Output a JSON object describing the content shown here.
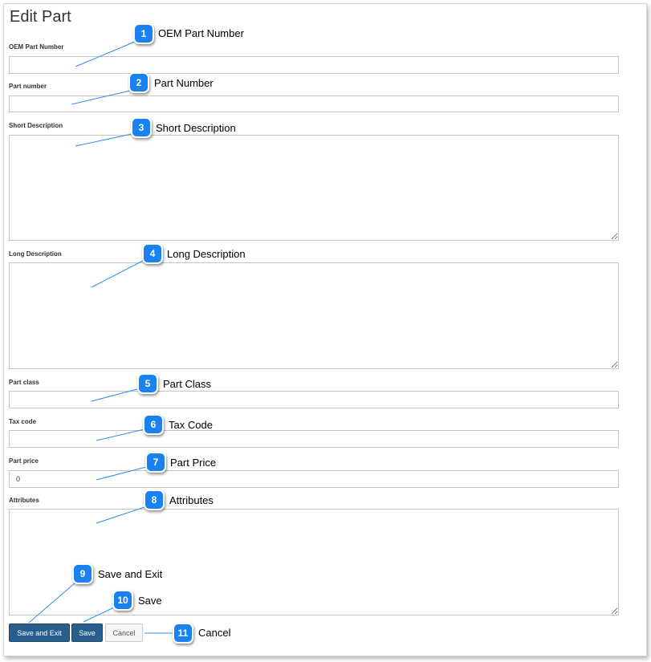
{
  "page_title": "Edit Part",
  "fields": {
    "oem_part_number": {
      "label": "OEM Part Number",
      "value": ""
    },
    "part_number": {
      "label": "Part number",
      "value": ""
    },
    "short_description": {
      "label": "Short Description",
      "value": ""
    },
    "long_description": {
      "label": "Long Description",
      "value": ""
    },
    "part_class": {
      "label": "Part class",
      "value": ""
    },
    "tax_code": {
      "label": "Tax code",
      "value": ""
    },
    "part_price": {
      "label": "Part price",
      "value": "0"
    },
    "attributes": {
      "label": "Attributes",
      "value": ""
    }
  },
  "buttons": {
    "save_and_exit": "Save and Exit",
    "save": "Save",
    "cancel": "Cancel"
  },
  "callouts": [
    {
      "number": "1",
      "text": "OEM Part Number"
    },
    {
      "number": "2",
      "text": "Part Number"
    },
    {
      "number": "3",
      "text": "Short Description"
    },
    {
      "number": "4",
      "text": "Long Description"
    },
    {
      "number": "5",
      "text": "Part Class"
    },
    {
      "number": "6",
      "text": "Tax Code"
    },
    {
      "number": "7",
      "text": "Part Price"
    },
    {
      "number": "8",
      "text": "Attributes"
    },
    {
      "number": "9",
      "text": "Save and Exit"
    },
    {
      "number": "10",
      "text": "Save"
    },
    {
      "number": "11",
      "text": "Cancel"
    }
  ],
  "colors": {
    "callout_badge": "#1a82f0",
    "callout_line": "#2d8cf0",
    "primary_button": "#285e8e"
  }
}
